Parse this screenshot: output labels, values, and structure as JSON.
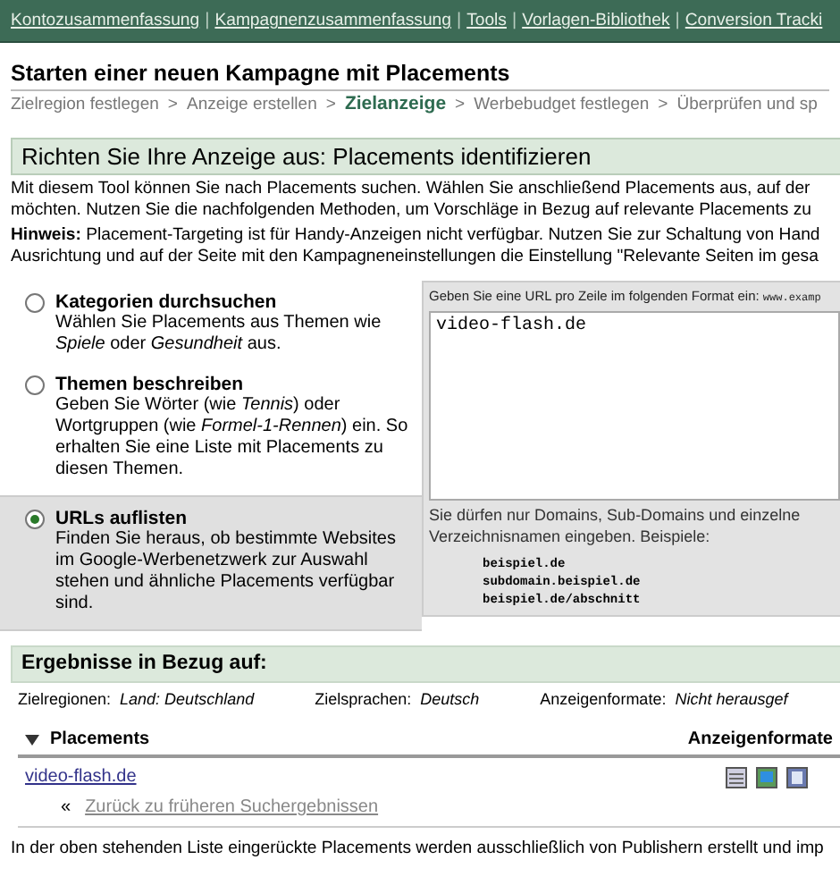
{
  "nav_links": [
    "Kontozusammenfassung",
    "Kampagnenzusammenfassung",
    "Tools",
    "Vorlagen-Bibliothek",
    "Conversion Tracki"
  ],
  "nav_separator": "|",
  "page_title": "Starten einer neuen Kampagne mit Placements",
  "steps": [
    {
      "label": "Zielregion festlegen",
      "selected": false
    },
    {
      "label": "Anzeige erstellen",
      "selected": false
    },
    {
      "label": "Zielanzeige",
      "selected": true
    },
    {
      "label": "Werbebudget festlegen",
      "selected": false
    },
    {
      "label": "Überprüfen und sp",
      "selected": false
    }
  ],
  "step_separator": ">",
  "section_title": "Richten Sie Ihre Anzeige aus: Placements identifizieren",
  "intro": [
    "Mit diesem Tool können Sie nach Placements suchen. Wählen Sie anschließend Placements aus, auf der",
    "möchten. Nutzen Sie die nachfolgenden Methoden, um Vorschläge in Bezug auf relevante Placements zu"
  ],
  "note": [
    "**Hinweis:** Placement-Targeting ist für Handy-Anzeigen nicht verfügbar. Nutzen Sie zur Schaltung von Hand",
    "Ausrichtung und auf der Seite mit den Kampagneneinstellungen die Einstellung \"Relevante Seiten im gesa"
  ],
  "methods": [
    {
      "title": "Kategorien durchsuchen",
      "description": "Wählen Sie Placements aus Themen wie *Spiele* oder *Gesundheit* aus.",
      "selected": false
    },
    {
      "title": "Themen beschreiben",
      "description": "Geben Sie Wörter (wie *Tennis*) oder Wortgruppen (wie *Formel-1-Rennen*) ein. So erhalten Sie eine Liste mit Placements zu diesen Themen.",
      "selected": false
    },
    {
      "title": "URLs auflisten",
      "description": "Finden Sie heraus, ob bestimmte Websites im Google-Werbenetzwerk zur Auswahl stehen und ähnliche Placements verfügbar sind.",
      "selected": true
    }
  ],
  "url_panel": {
    "instruction": "Geben Sie eine URL pro Zeile im folgenden Format ein:",
    "format_example": "www.examp",
    "value": "video-flash.de",
    "help": "Sie dürfen nur Domains, Sub-Domains und einzelne Verzeichnisnamen eingeben. Beispiele:",
    "examples": [
      "beispiel.de",
      "subdomain.beispiel.de",
      "beispiel.de/abschnitt"
    ]
  },
  "results": {
    "title": "Ergebnisse in Bezug auf:",
    "criteria": [
      {
        "label": "Zielregionen:",
        "value": "Land: Deutschland"
      },
      {
        "label": "Zielsprachen:",
        "value": "Deutsch"
      },
      {
        "label": "Anzeigenformate:",
        "value": "Nicht herausgef"
      }
    ],
    "columns": [
      "Placements",
      "Anzeigenformate"
    ],
    "expanded": true,
    "rows": [
      {
        "placement": "video-flash.de"
      }
    ],
    "back_mark": "«",
    "back_link": "Zurück zu früheren Suchergebnissen"
  },
  "footer": "In der oben stehenden Liste eingerückte Placements werden ausschließlich von Publishern erstellt und imp"
}
